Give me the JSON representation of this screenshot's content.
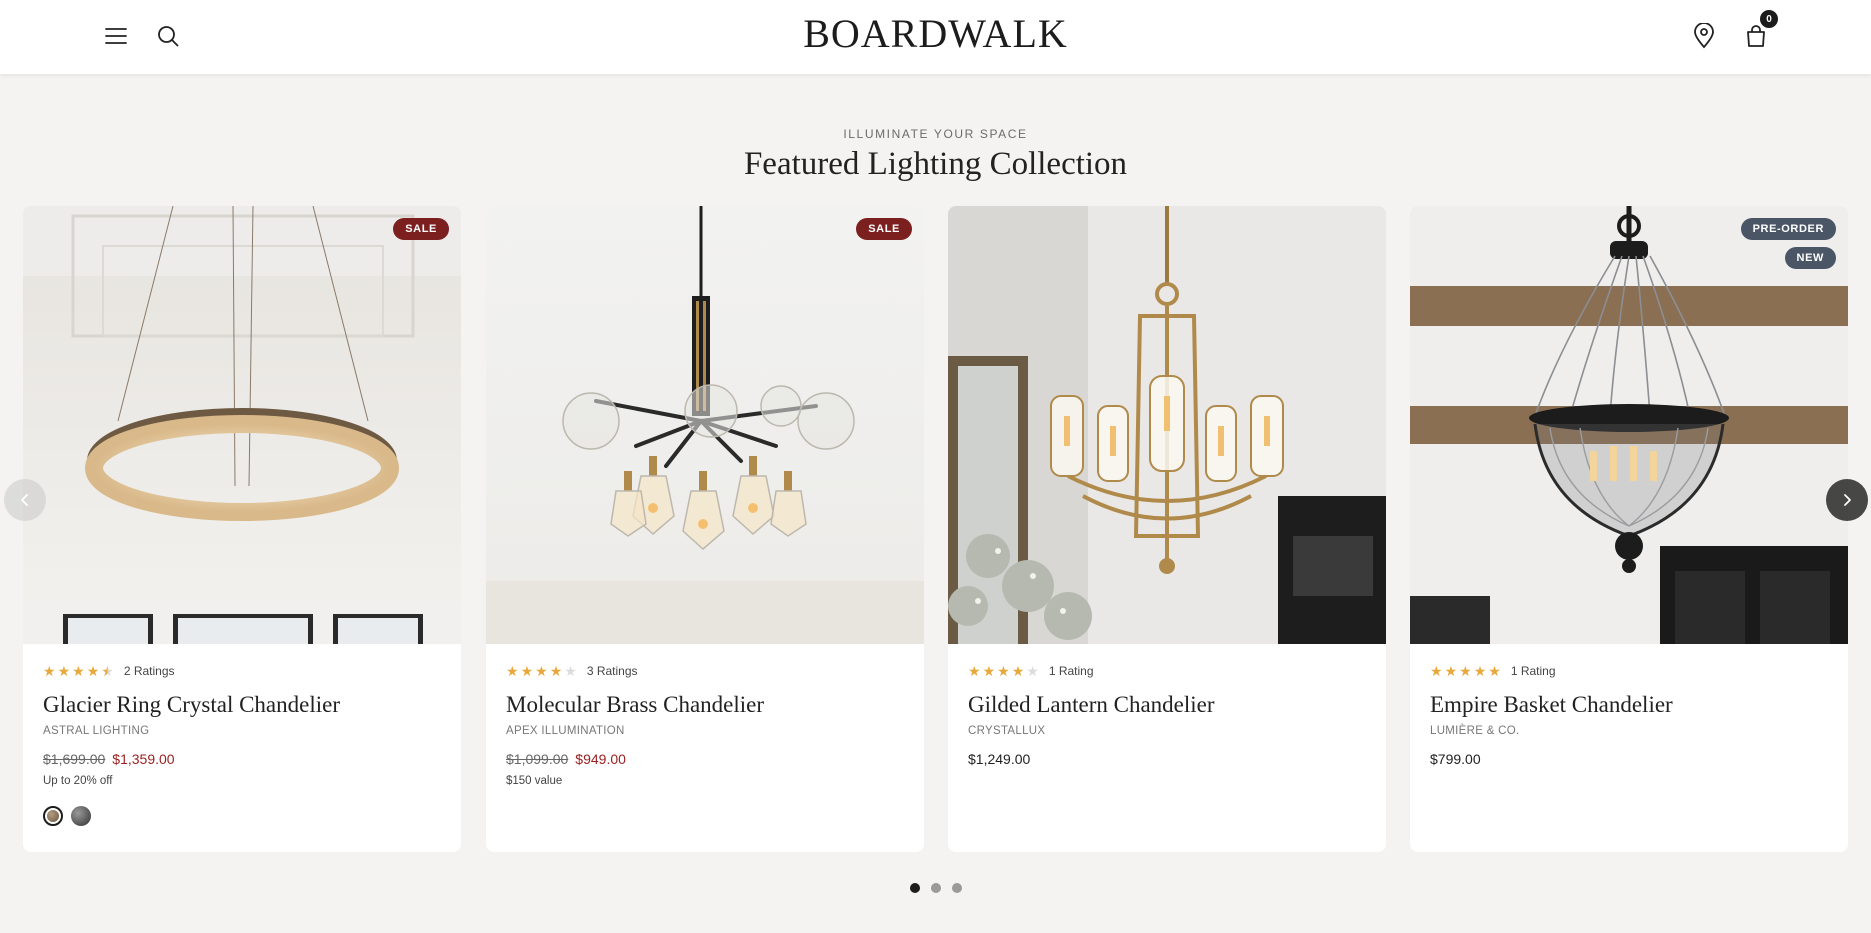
{
  "header": {
    "logo": "BOARDWALK",
    "menu_icon": "hamburger-menu-icon",
    "search_icon": "search-icon",
    "location_icon": "location-pin-icon",
    "cart_icon": "shopping-bag-icon",
    "cart_count": "0"
  },
  "section": {
    "eyebrow": "ILLUMINATE YOUR SPACE",
    "title": "Featured Lighting Collection"
  },
  "products": [
    {
      "name": "Glacier Ring Crystal Chandelier",
      "brand": "ASTRAL LIGHTING",
      "rating": 4.5,
      "rating_text": "2 Ratings",
      "old_price": "$1,699.00",
      "price": "$1,359.00",
      "promo": "Up to 20% off",
      "badges": [
        "SALE"
      ],
      "swatches": [
        "#8a7258",
        "#4a4a4a"
      ]
    },
    {
      "name": "Molecular Brass Chandelier",
      "brand": "APEX ILLUMINATION",
      "rating": 4,
      "rating_text": "3 Ratings",
      "old_price": "$1,099.00",
      "price": "$949.00",
      "promo": "$150 value",
      "badges": [
        "SALE"
      ]
    },
    {
      "name": "Gilded Lantern Chandelier",
      "brand": "CRYSTALLUX",
      "rating": 4,
      "rating_text": "1 Rating",
      "price": "$1,249.00",
      "badges": []
    },
    {
      "name": "Empire Basket Chandelier",
      "brand": "LUMIÈRE & CO.",
      "rating": 5,
      "rating_text": "1 Rating",
      "price": "$799.00",
      "badges": [
        "PRE-ORDER",
        "NEW"
      ]
    }
  ],
  "carousel": {
    "prev_icon": "chevron-left-icon",
    "next_icon": "chevron-right-icon",
    "pages": 3,
    "active_page": 1
  },
  "colors": {
    "accent_sale": "#7b1f1f",
    "sale_price": "#9a1f1f",
    "star": "#e8a83b",
    "badge_dark": "#4a5566"
  }
}
